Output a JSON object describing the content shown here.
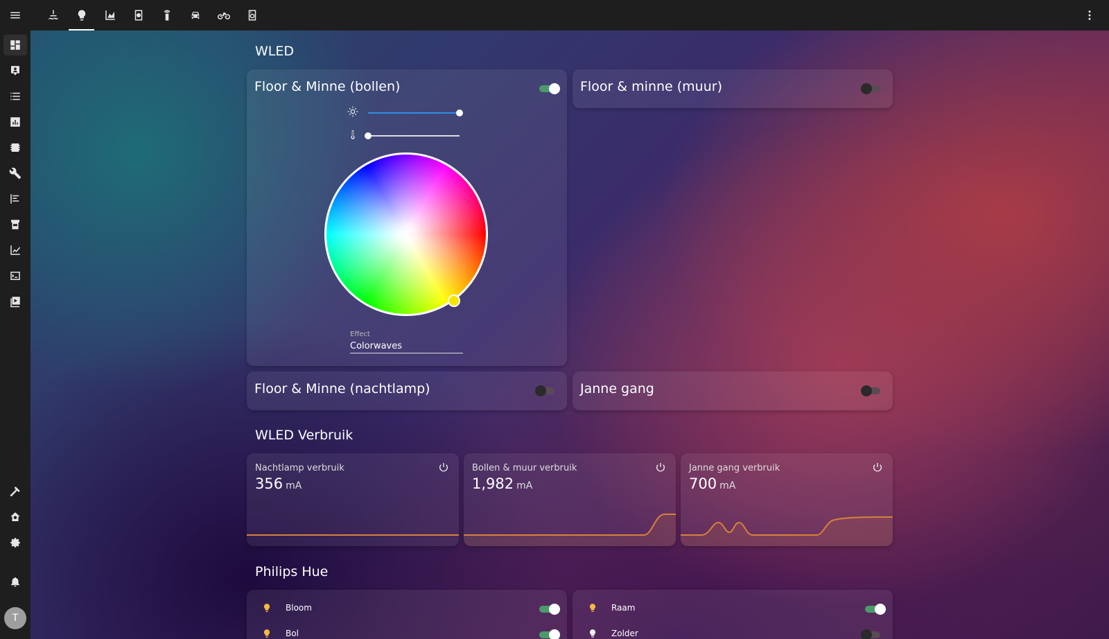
{
  "topbar": {
    "tabs": [
      {
        "icon": "water-heater-icon"
      },
      {
        "icon": "lightbulb-icon",
        "active": true
      },
      {
        "icon": "area-chart-icon"
      },
      {
        "icon": "robot-vacuum-icon"
      },
      {
        "icon": "remote-icon"
      },
      {
        "icon": "car-icon"
      },
      {
        "icon": "bicycle-icon"
      },
      {
        "icon": "washing-machine-icon"
      }
    ]
  },
  "sidebar": {
    "items": [
      "dashboard-icon",
      "map-icon",
      "logbook-icon",
      "history-icon",
      "energy-icon",
      "developer-tools-icon",
      "todo-icon",
      "hacs-icon",
      "statistics-icon",
      "terminal-icon",
      "media-icon"
    ],
    "bottom": [
      "hammer-icon",
      "home-settings-icon",
      "settings-icon",
      "bell-icon"
    ],
    "avatar": "T"
  },
  "wled": {
    "title": "WLED",
    "cards": [
      {
        "name": "Floor & Minne (bollen)",
        "on": true
      },
      {
        "name": "Floor & minne (muur)",
        "on": false
      },
      {
        "name": "Floor & Minne (nachtlamp)",
        "on": false
      },
      {
        "name": "Janne gang",
        "on": false
      }
    ],
    "brightness_level": 1.0,
    "color_temp_level": 0.0,
    "effect_label": "Effect",
    "effect_value": "Colorwaves"
  },
  "verbruik": {
    "title": "WLED Verbruik",
    "stats": [
      {
        "name": "Nachtlamp verbruik",
        "value": "356",
        "unit": "mA"
      },
      {
        "name": "Bollen & muur verbruik",
        "value": "1,982",
        "unit": "mA"
      },
      {
        "name": "Janne gang verbruik",
        "value": "700",
        "unit": "mA"
      }
    ]
  },
  "hue": {
    "title": "Philips Hue",
    "left": [
      {
        "name": "Bloom",
        "on": true
      },
      {
        "name": "Bol",
        "on": true
      }
    ],
    "right": [
      {
        "name": "Raam",
        "on": true
      },
      {
        "name": "Zolder",
        "on": false
      }
    ]
  },
  "colors": {
    "accent_orange": "#d9813a",
    "toggle_on": "#4b9a6a",
    "bulb_on": "#f5b942"
  }
}
